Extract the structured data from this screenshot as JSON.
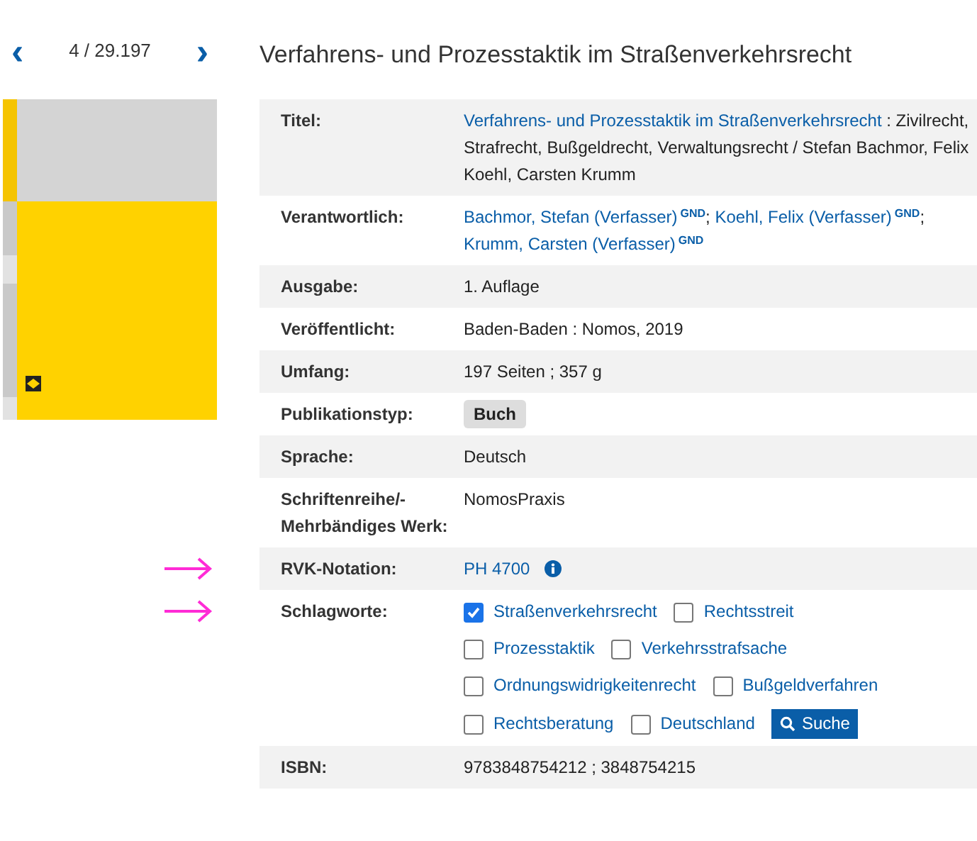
{
  "nav": {
    "prev": "‹",
    "position": "4 / 29.197",
    "next": "›"
  },
  "heading": "Verfahrens- und Prozesstaktik im Straßenverkehrsrecht",
  "rows": [
    {
      "label": "Titel:",
      "value": [
        {
          "kind": "link",
          "text": "Verfahrens- und Prozesstaktik im Straßenverkehrsrecht"
        },
        {
          "kind": "text",
          "text": " : Zivilrecht, Strafrecht, Bußgeldrecht, Verwaltungsrecht / Stefan Bachmor, Felix Koehl, Carsten Krumm"
        }
      ]
    },
    {
      "label": "Verantwortlich:",
      "value": [
        {
          "kind": "link",
          "text": "Bachmor, Stefan (Verfasser)"
        },
        {
          "kind": "badge",
          "text": "GND"
        },
        {
          "kind": "text",
          "text": "; "
        },
        {
          "kind": "link",
          "text": "Koehl, Felix (Verfasser)"
        },
        {
          "kind": "badge",
          "text": "GND"
        },
        {
          "kind": "text",
          "text": "; "
        },
        {
          "kind": "link",
          "text": "Krumm, Carsten (Verfasser)"
        },
        {
          "kind": "badge",
          "text": "GND"
        }
      ]
    },
    {
      "label": "Ausgabe:",
      "value": [
        {
          "kind": "text",
          "text": "1. Auflage"
        }
      ]
    },
    {
      "label": "Veröffentlicht:",
      "value": [
        {
          "kind": "text",
          "text": "Baden-Baden : Nomos, 2019"
        }
      ]
    },
    {
      "label": "Umfang:",
      "value": [
        {
          "kind": "text",
          "text": "197 Seiten ; 357 g"
        }
      ]
    },
    {
      "label": "Publikationstyp:",
      "value": [
        {
          "kind": "tag",
          "text": "Buch"
        }
      ]
    },
    {
      "label": "Sprache:",
      "value": [
        {
          "kind": "text",
          "text": "Deutsch"
        }
      ]
    },
    {
      "label": "Schriftenreihe/-Mehrbändiges Werk:",
      "value": [
        {
          "kind": "text",
          "text": "NomosPraxis"
        }
      ]
    },
    {
      "label": "RVK-Notation:",
      "marked": true,
      "value": [
        {
          "kind": "link",
          "text": "PH 4700"
        },
        {
          "kind": "info"
        }
      ]
    },
    {
      "label": "Schlagworte:",
      "marked": true,
      "value": [
        {
          "kind": "keywords",
          "items": [
            {
              "label": "Straßenverkehrsrecht",
              "checked": true
            },
            {
              "label": "Rechtsstreit",
              "checked": false
            },
            {
              "label": "Prozesstaktik",
              "checked": false
            },
            {
              "label": "Verkehrsstrafsache",
              "checked": false
            },
            {
              "label": "Ordnungswidrigkeitenrecht",
              "checked": false
            },
            {
              "label": "Bußgeldverfahren",
              "checked": false
            },
            {
              "label": "Rechtsberatung",
              "checked": false
            },
            {
              "label": "Deutschland",
              "checked": false
            }
          ],
          "button": "Suche"
        }
      ]
    },
    {
      "label": "ISBN:",
      "value": [
        {
          "kind": "text",
          "text": "9783848754212 ; 3848754215"
        }
      ]
    }
  ]
}
